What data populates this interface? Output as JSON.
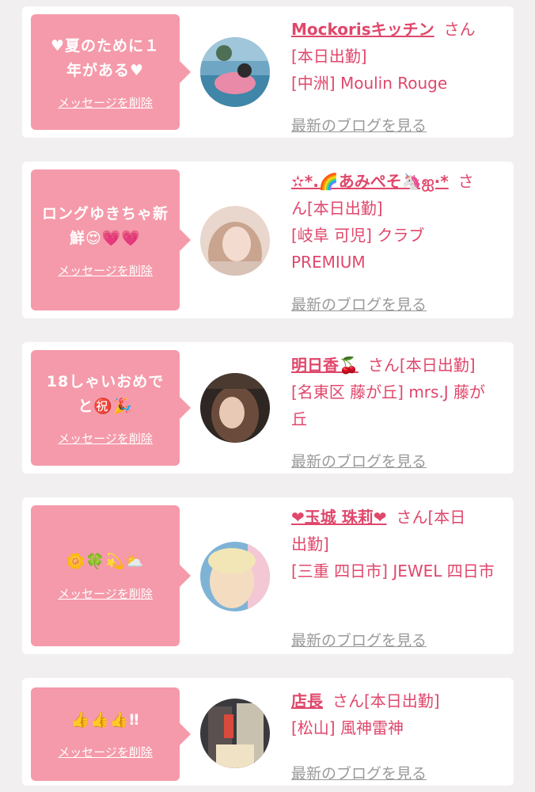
{
  "items": [
    {
      "message": "♥夏のために１年がある♥",
      "delete_label": "メッセージを削除",
      "name": "Mockorisキッチン",
      "san": "さん",
      "status": "[本日出勤]",
      "shop": "[中洲] Moulin Rouge",
      "blog_label": "最新のブログを見る"
    },
    {
      "message": "ロングゆきちゃ新鮮😍💗💗",
      "delete_label": "メッセージを削除",
      "name": "✫*.🌈あみぺそ🦄ஐ·*",
      "san": "さ",
      "status": "ん[本日出勤]",
      "shop": "[岐阜 可児] クラブPREMIUM",
      "blog_label": "最新のブログを見る"
    },
    {
      "message": "18しゃいおめでと㊗️🎉",
      "delete_label": "メッセージを削除",
      "name": "明日香🍒",
      "san": "さん[本日出勤]",
      "status": "",
      "shop": "[名東区 藤が丘] mrs.J 藤が丘",
      "blog_label": "最新のブログを見る"
    },
    {
      "message": "🌼🍀💫⛅",
      "delete_label": "メッセージを削除",
      "name": "❤玉城 珠莉❤",
      "san": "さん[本日",
      "status": "出勤]",
      "shop": "[三重 四日市] JEWEL 四日市",
      "blog_label": "最新のブログを見る"
    },
    {
      "message": "👍👍👍‼",
      "delete_label": "メッセージを削除",
      "name": "店長",
      "san": "さん[本日出勤]",
      "status": "",
      "shop": "[松山] 風神雷神",
      "blog_label": "最新のブログを見る"
    }
  ]
}
